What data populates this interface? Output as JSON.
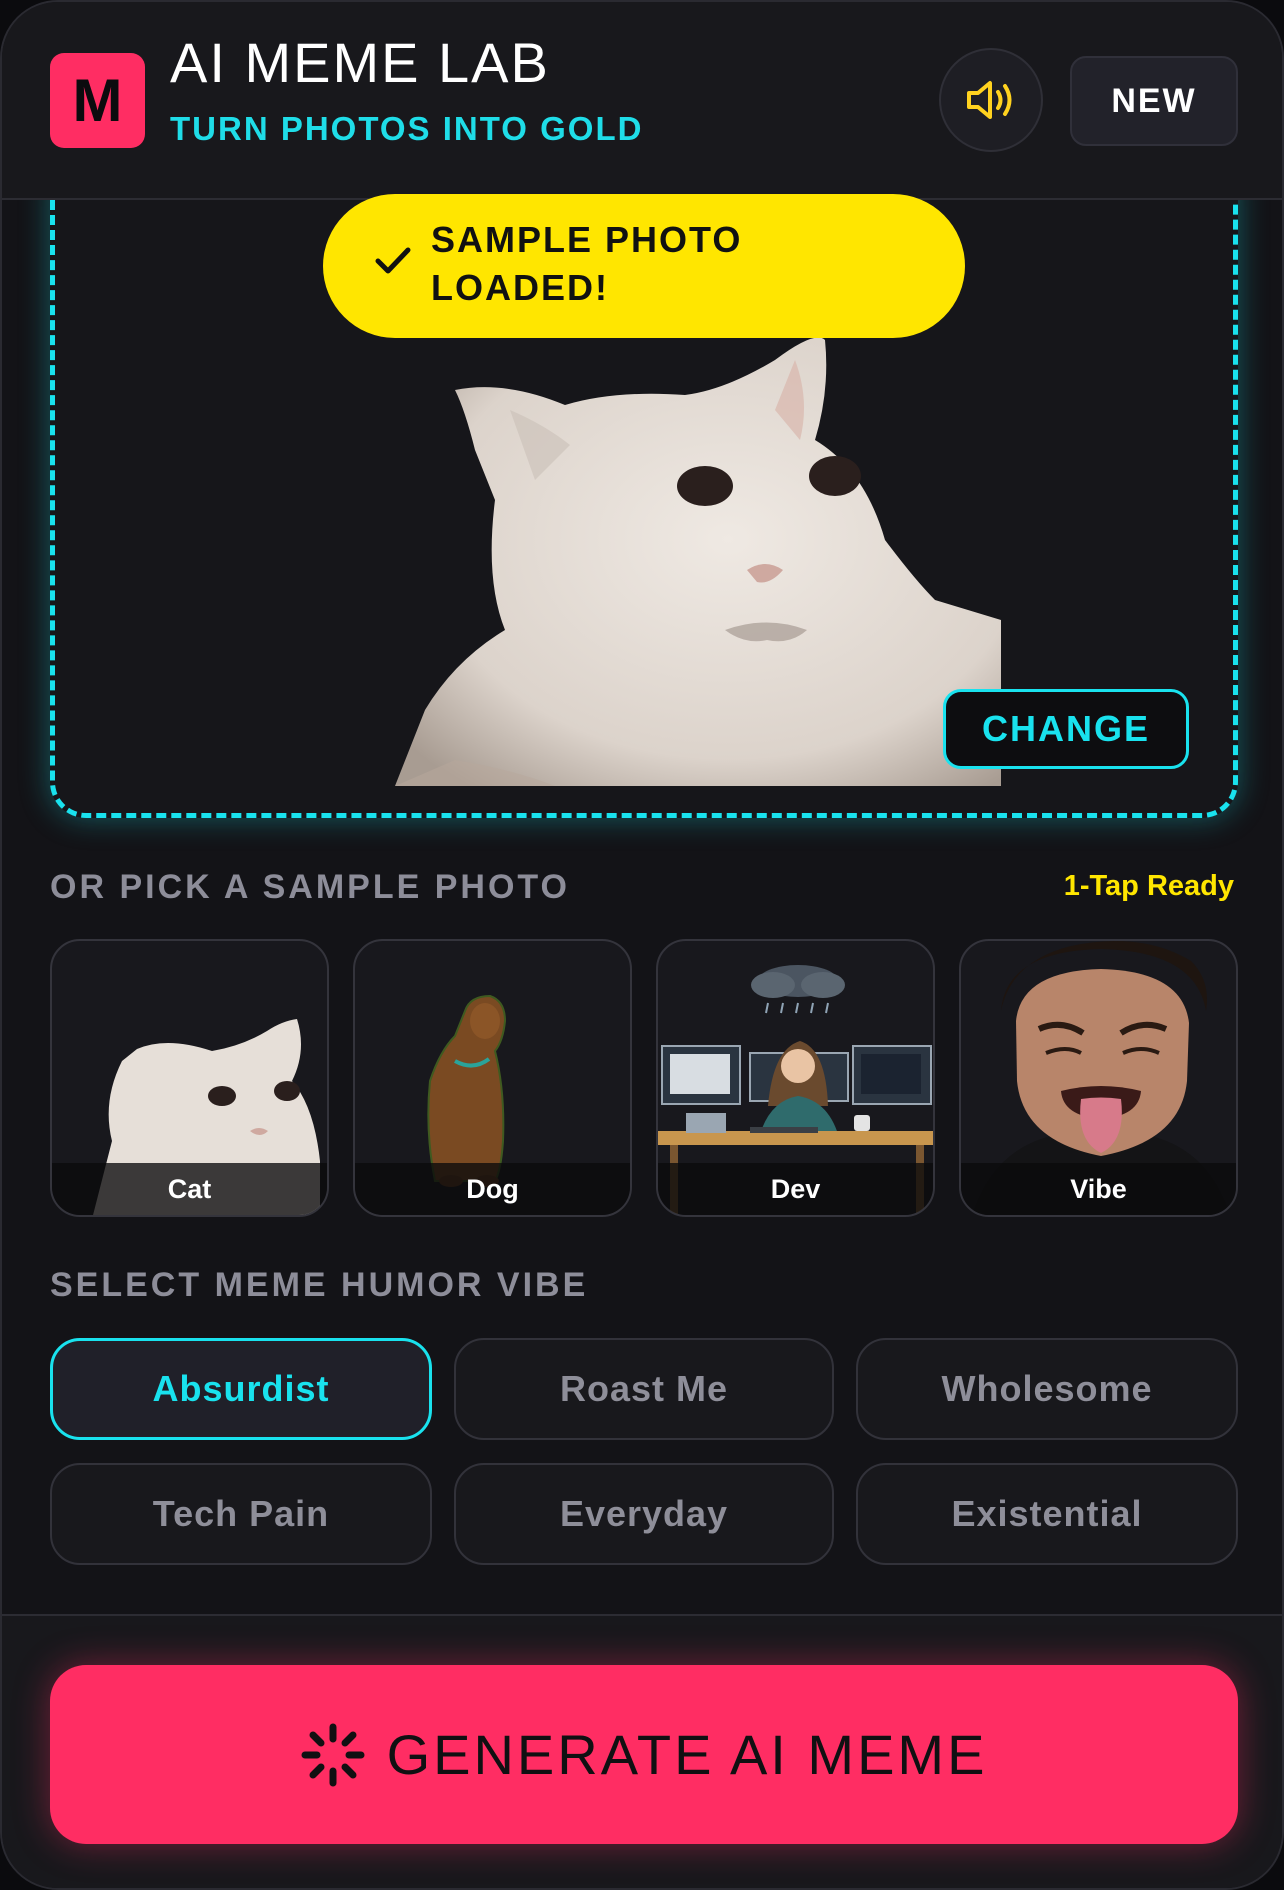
{
  "header": {
    "logo_letter": "M",
    "title": "AI MEME LAB",
    "subtitle": "TURN PHOTOS INTO GOLD",
    "sound_icon": "speaker-icon",
    "new_label": "NEW"
  },
  "upload": {
    "toast": "SAMPLE PHOTO LOADED!",
    "change_label": "CHANGE"
  },
  "samples": {
    "heading": "OR PICK A SAMPLE PHOTO",
    "tag": "1-Tap Ready",
    "items": [
      {
        "label": "Cat"
      },
      {
        "label": "Dog"
      },
      {
        "label": "Dev"
      },
      {
        "label": "Vibe"
      }
    ]
  },
  "vibes": {
    "heading": "SELECT MEME HUMOR VIBE",
    "options": [
      {
        "label": "Absurdist",
        "selected": true
      },
      {
        "label": "Roast Me",
        "selected": false
      },
      {
        "label": "Wholesome",
        "selected": false
      },
      {
        "label": "Tech Pain",
        "selected": false
      },
      {
        "label": "Everyday",
        "selected": false
      },
      {
        "label": "Existential",
        "selected": false
      }
    ]
  },
  "footer": {
    "generate_label": "GENERATE AI MEME",
    "generate_icon": "sparkle-loader-icon"
  },
  "colors": {
    "accent_cyan": "#19e2ee",
    "accent_pink": "#ff2d63",
    "accent_yellow": "#ffe600",
    "background": "#131317"
  }
}
